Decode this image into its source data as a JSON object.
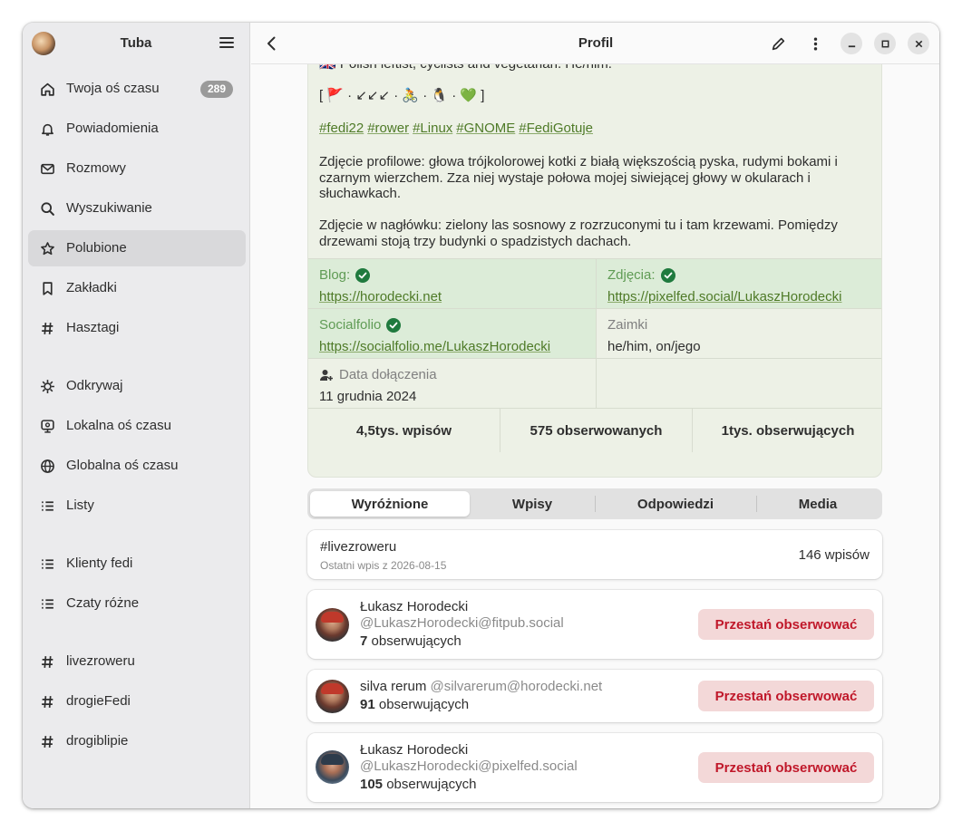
{
  "sidebar": {
    "title": "Tuba",
    "items": [
      {
        "label": "Twoja oś czasu",
        "icon": "home-icon",
        "badge": "289"
      },
      {
        "label": "Powiadomienia",
        "icon": "bell-icon"
      },
      {
        "label": "Rozmowy",
        "icon": "mail-icon"
      },
      {
        "label": "Wyszukiwanie",
        "icon": "search-icon"
      },
      {
        "label": "Polubione",
        "icon": "star-icon"
      },
      {
        "label": "Zakładki",
        "icon": "bookmark-icon"
      },
      {
        "label": "Hasztagi",
        "icon": "hashtag-icon"
      },
      {
        "label": "Odkrywaj",
        "icon": "explore-icon"
      },
      {
        "label": "Lokalna oś czasu",
        "icon": "local-timeline-icon"
      },
      {
        "label": "Globalna oś czasu",
        "icon": "globe-icon"
      },
      {
        "label": "Listy",
        "icon": "list-icon"
      },
      {
        "label": "Klienty fedi",
        "icon": "list-icon"
      },
      {
        "label": "Czaty różne",
        "icon": "list-icon"
      },
      {
        "label": "livezroweru",
        "icon": "hashtag-icon"
      },
      {
        "label": "drogieFedi",
        "icon": "hashtag-icon"
      },
      {
        "label": "drogiblipie",
        "icon": "hashtag-icon"
      }
    ],
    "active_item": "Polubione"
  },
  "header": {
    "title": "Profil"
  },
  "profile": {
    "bio_line1": "🇬🇧 Polish leftist, cyclists and vegetarian. He/him.",
    "bio_line2": "[ 🚩 · ↙↙↙ · 🚴 · 🐧 · 💚 ]",
    "hashtags": [
      "#fedi22",
      "#rower",
      "#Linux",
      "#GNOME",
      "#FediGotuje"
    ],
    "bio_avatar": "Zdjęcie profilowe: głowa trójkolorowej kotki z białą większością pyska, rudymi bokami i czarnym wierzchem. Zza niej wystaje połowa mojej siwiejącej głowy w okularach i słuchawkach.",
    "bio_header": "Zdjęcie w nagłówku: zielony las sosnowy z rozrzuconymi tu i tam krzewami. Pomiędzy drzewami stoją trzy budynki o spadzistych dachach.",
    "fields": [
      {
        "name": "Blog:",
        "value": "https://horodecki.net",
        "verified": true
      },
      {
        "name": "Zdjęcia:",
        "value": "https://pixelfed.social/LukaszHorodecki",
        "verified": true
      },
      {
        "name": "Socialfolio",
        "value": "https://socialfolio.me/LukaszHorodecki",
        "verified": true
      },
      {
        "name": "Zaimki",
        "value": "he/him, on/jego",
        "verified": false
      }
    ],
    "joined_label": "Data dołączenia",
    "joined_value": "11 grudnia 2024",
    "stats": {
      "posts": "4,5tys. wpisów",
      "following": "575 obserwowanych",
      "followers": "1tys. obserwujących"
    }
  },
  "tabs": [
    "Wyróżnione",
    "Wpisy",
    "Odpowiedzi",
    "Media"
  ],
  "active_tab": "Wyróżnione",
  "featured_hashtag": {
    "name": "#livezroweru",
    "last_post": "Ostatni wpis z 2026-08-15",
    "count": "146 wpisów"
  },
  "accounts": [
    {
      "name": "Łukasz Horodecki",
      "handle": "@LukaszHorodecki@fitpub.social",
      "followers_num": "7",
      "followers_label": "obserwujących",
      "action": "Przestań obserwować"
    },
    {
      "name": "silva rerum",
      "handle": "@silvarerum@horodecki.net",
      "followers_num": "91",
      "followers_label": "obserwujących",
      "action": "Przestań obserwować"
    },
    {
      "name": "Łukasz Horodecki",
      "handle": "@LukaszHorodecki@pixelfed.social",
      "followers_num": "105",
      "followers_label": "obserwujących",
      "action": "Przestań obserwować"
    }
  ],
  "colors": {
    "accent_link": "#4e7a27",
    "verified_bg": "#dcecd8",
    "destructive": "#c0182a",
    "destructive_bg": "#f3d8d8"
  }
}
